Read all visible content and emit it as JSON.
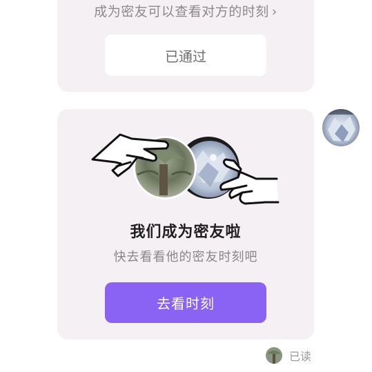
{
  "top_card": {
    "hint_text": "成为密友可以查看对方的时刻",
    "chevron_glyph": "›",
    "status_button": "已通过"
  },
  "main_card": {
    "title": "我们成为密友啦",
    "subtitle": "快去看看他的密友时刻吧",
    "action_button": "去看时刻"
  },
  "read_receipt": {
    "label": "已读"
  },
  "colors": {
    "card_bg": "#f5f0f4",
    "accent": "#8b63f4",
    "muted_text": "#888888"
  },
  "icons": [
    "chevron-right-icon",
    "hand-left-icon",
    "hand-right-icon",
    "avatar-photo"
  ]
}
